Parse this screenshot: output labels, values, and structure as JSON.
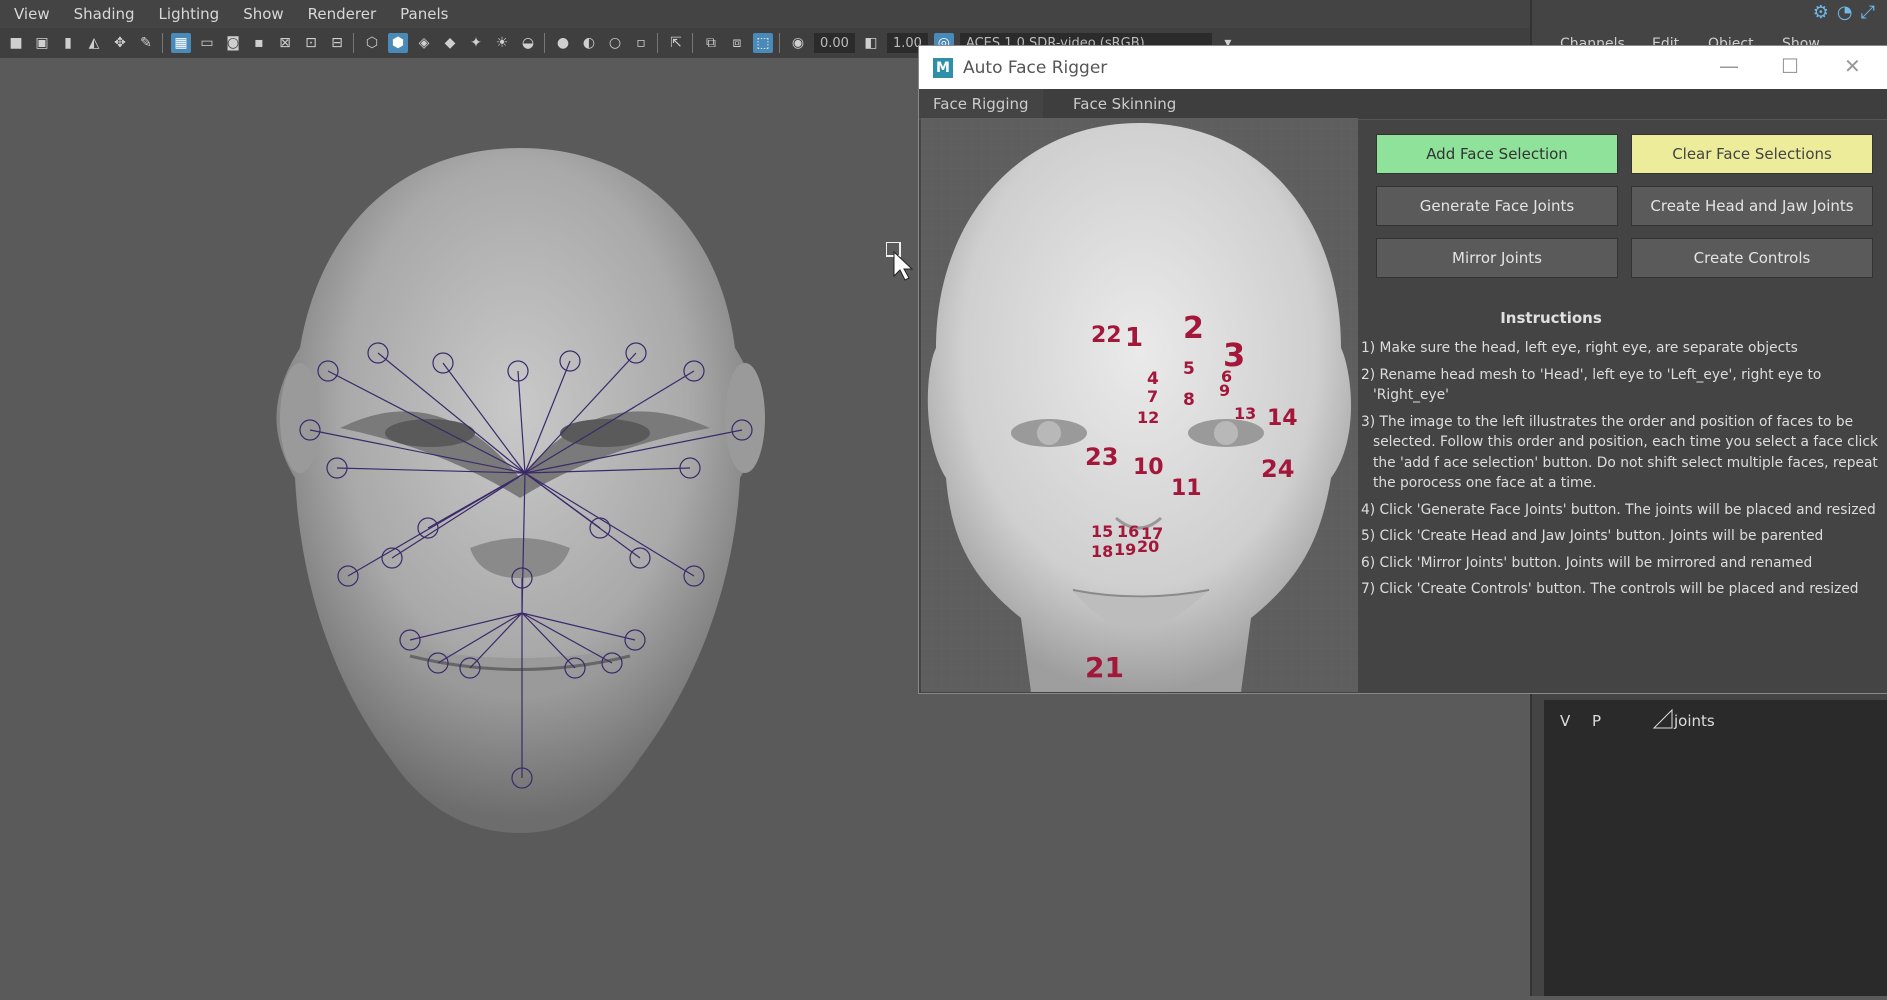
{
  "menubar": {
    "items": [
      "View",
      "Shading",
      "Lighting",
      "Show",
      "Renderer",
      "Panels"
    ]
  },
  "toolbar": {
    "field1": "0.00",
    "field2": "1.00",
    "colorspace": "ACES 1.0 SDR-video (sRGB)"
  },
  "rightpanel": {
    "menu": [
      "Channels",
      "Edit",
      "Object",
      "Show"
    ],
    "layer_v": "V",
    "layer_p": "P",
    "layer_name": "joints"
  },
  "window": {
    "title": "Auto Face Rigger",
    "tabs": [
      "Face Rigging",
      "Face Skinning"
    ],
    "buttons": {
      "add": "Add Face Selection",
      "clear": "Clear Face Selections",
      "generate": "Generate Face Joints",
      "create_head": "Create Head and Jaw Joints",
      "mirror": "Mirror Joints",
      "controls": "Create Controls"
    },
    "instructions_title": "Instructions",
    "instructions": [
      "1) Make sure the head, left eye, right eye, are separate objects",
      "2) Rename head mesh to 'Head', left eye to 'Left_eye', right eye to 'Right_eye'",
      "3) The image to the left illustrates the order and position of faces to be selected. Follow this order and position, each time you select a face click the 'add f ace selection' button. Do not shift select multiple faces, repeat the porocess one face at a time.",
      "4) Click 'Generate Face Joints' button. The joints will be placed and resized",
      "5) Click 'Create Head and Jaw Joints' button. Joints will be parented",
      "6) Click 'Mirror Joints' button. Joints will be mirrored and renamed",
      "7) Click 'Create Controls' button. The controls will be placed and resized"
    ],
    "face_numbers": [
      "1",
      "2",
      "3",
      "4",
      "5",
      "6",
      "7",
      "8",
      "9",
      "10",
      "11",
      "12",
      "13",
      "14",
      "15",
      "16",
      "17",
      "18",
      "19",
      "20",
      "21",
      "22",
      "23",
      "24"
    ]
  },
  "colors": {
    "accent_green": "#8ee29a",
    "accent_yellow": "#ecec9a",
    "number_red": "#a3173a",
    "joint_purple": "#3a2a6a"
  }
}
